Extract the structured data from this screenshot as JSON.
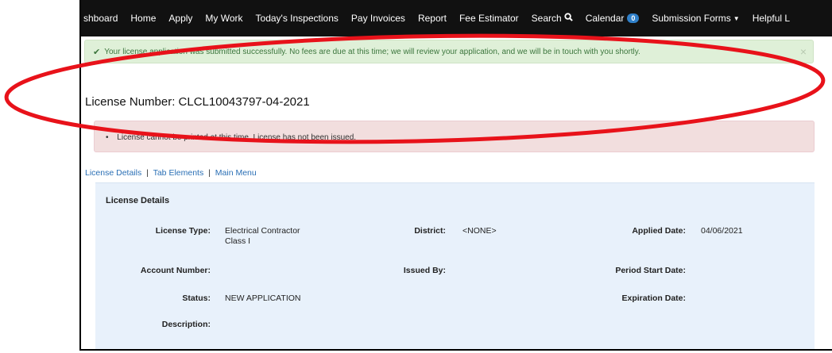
{
  "nav": {
    "items": [
      "shboard",
      "Home",
      "Apply",
      "My Work",
      "Today's Inspections",
      "Pay Invoices",
      "Report",
      "Fee Estimator"
    ],
    "search_label": "Search",
    "calendar_label": "Calendar",
    "calendar_count": "0",
    "submission_forms_label": "Submission Forms",
    "helpful_label": "Helpful L"
  },
  "success_alert": {
    "message": "Your license application was submitted successfully. No fees are due at this time; we will review your application, and we will be in touch with you shortly.",
    "close": "×"
  },
  "license_number_heading": "License Number: CLCL10043797-04-2021",
  "error_alert": {
    "message": "License cannot be printed at this time. License has not been issued."
  },
  "links": {
    "license_details": "License Details",
    "tab_elements": "Tab Elements",
    "main_menu": "Main Menu",
    "separator": "|"
  },
  "details": {
    "title": "License Details",
    "license_type_label": "License Type:",
    "license_type_line1": "Electrical Contractor",
    "license_type_line2": "Class I",
    "district_label": "District:",
    "district_value": "<NONE>",
    "applied_date_label": "Applied Date:",
    "applied_date_value": "04/06/2021",
    "account_number_label": "Account Number:",
    "issued_by_label": "Issued By:",
    "period_start_label": "Period Start Date:",
    "status_label": "Status:",
    "status_value": "NEW APPLICATION",
    "expiration_label": "Expiration Date:",
    "description_label": "Description:"
  },
  "colors": {
    "annotation_oval": "#e8121a",
    "success_bg": "#dff0d8",
    "danger_bg": "#f2dede",
    "details_bg": "#e8f1fb"
  }
}
